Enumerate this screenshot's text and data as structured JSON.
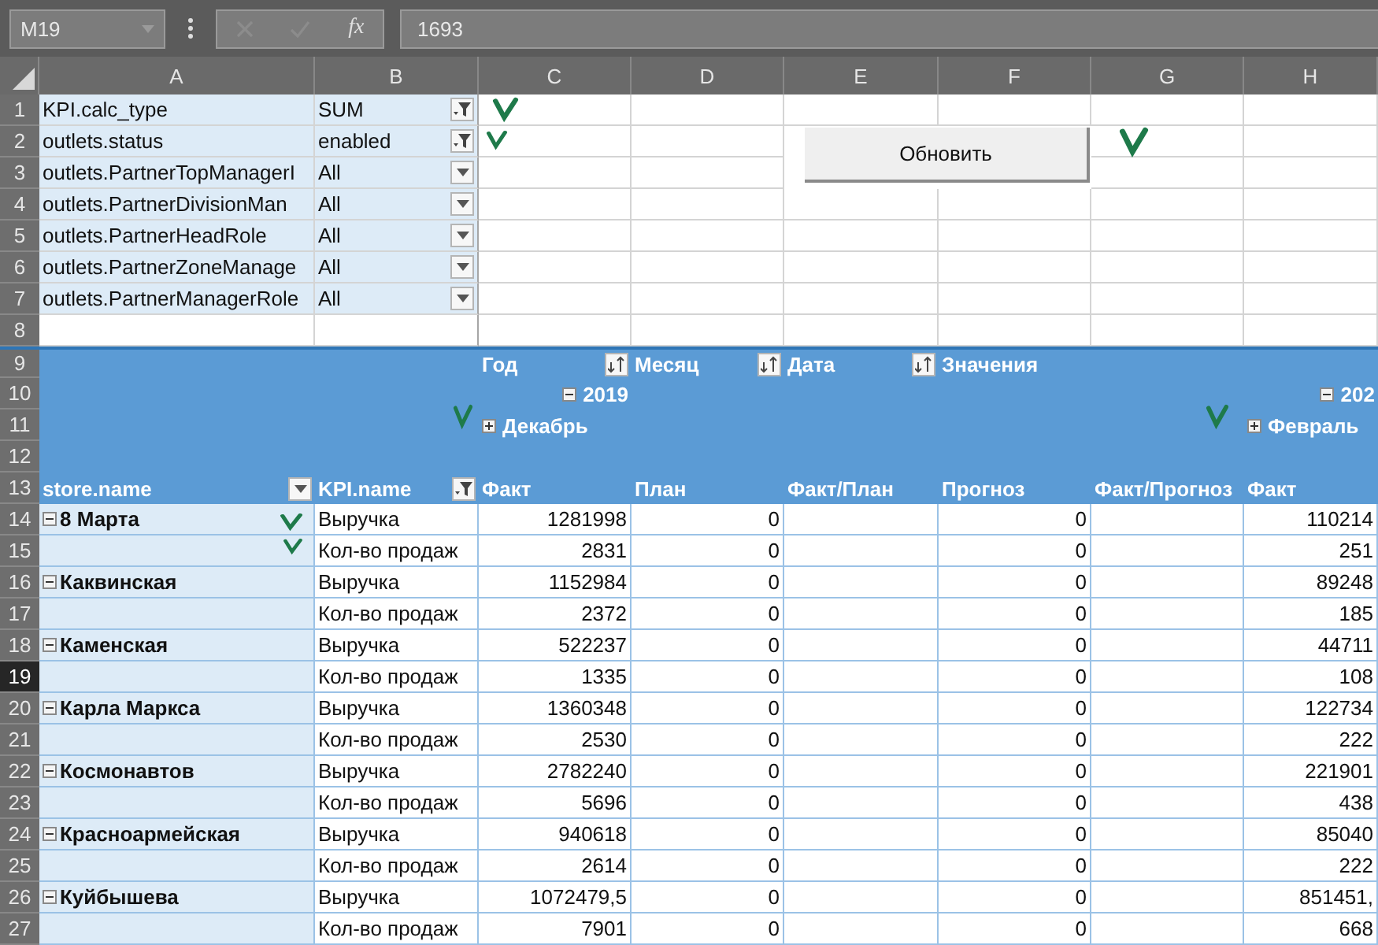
{
  "formula_bar": {
    "name_box": "M19",
    "fx_label": "fx",
    "formula": "1693"
  },
  "columns": [
    "A",
    "B",
    "C",
    "D",
    "E",
    "F",
    "G",
    "H"
  ],
  "row_numbers": [
    {
      "label": "1",
      "selected": false
    },
    {
      "label": "2",
      "selected": false
    },
    {
      "label": "3",
      "selected": false
    },
    {
      "label": "4",
      "selected": false
    },
    {
      "label": "5",
      "selected": false
    },
    {
      "label": "6",
      "selected": false
    },
    {
      "label": "7",
      "selected": false
    },
    {
      "label": "8",
      "selected": false
    },
    {
      "label": "9",
      "selected": false
    },
    {
      "label": "10",
      "selected": false
    },
    {
      "label": "11",
      "selected": false
    },
    {
      "label": "12",
      "selected": false
    },
    {
      "label": "13",
      "selected": false
    },
    {
      "label": "14",
      "selected": false
    },
    {
      "label": "15",
      "selected": false
    },
    {
      "label": "16",
      "selected": false
    },
    {
      "label": "17",
      "selected": false
    },
    {
      "label": "18",
      "selected": false
    },
    {
      "label": "19",
      "selected": true
    },
    {
      "label": "20",
      "selected": false
    },
    {
      "label": "21",
      "selected": false
    },
    {
      "label": "22",
      "selected": false
    },
    {
      "label": "23",
      "selected": false
    },
    {
      "label": "24",
      "selected": false
    },
    {
      "label": "25",
      "selected": false
    },
    {
      "label": "26",
      "selected": false
    },
    {
      "label": "27",
      "selected": false
    }
  ],
  "report_filters": [
    {
      "field": "KPI.calc_type",
      "value": "SUM",
      "filtered": true
    },
    {
      "field": "outlets.status",
      "value": "enabled",
      "filtered": true
    },
    {
      "field": "outlets.PartnerTopManagerI",
      "value": "All",
      "filtered": false
    },
    {
      "field": "outlets.PartnerDivisionMan",
      "value": "All",
      "filtered": false
    },
    {
      "field": "outlets.PartnerHeadRole",
      "value": "All",
      "filtered": false
    },
    {
      "field": "outlets.PartnerZoneManage",
      "value": "All",
      "filtered": false
    },
    {
      "field": "outlets.PartnerManagerRole",
      "value": "All",
      "filtered": false
    }
  ],
  "refresh_button": "Обновить",
  "pivot": {
    "column_fields": [
      {
        "label": "Год",
        "kind": "field"
      },
      {
        "label": "Месяц",
        "kind": "field"
      },
      {
        "label": "Дата",
        "kind": "field"
      },
      {
        "label": "Значения",
        "kind": "values"
      }
    ],
    "year_groups": [
      {
        "label": "2019",
        "expanded": true
      },
      {
        "label": "202",
        "expanded": true
      }
    ],
    "month_groups": [
      {
        "label": "Декабрь",
        "expanded": false
      },
      {
        "label": "Февраль",
        "expanded": false
      }
    ],
    "row_headers": [
      {
        "label": "store.name",
        "filtered": false
      },
      {
        "label": "KPI.name",
        "filtered": true
      }
    ],
    "value_headers": [
      "Факт",
      "План",
      "Факт/План",
      "Прогноз",
      "Факт/Прогноз",
      "Факт"
    ],
    "stores": [
      {
        "name": "8 Марта",
        "expanded": true,
        "rows": [
          {
            "kpi": "Выручка",
            "fact": "1281998",
            "plan": "0",
            "forecast": "0",
            "fact_2": "110214"
          },
          {
            "kpi": "Кол-во продаж",
            "fact": "2831",
            "plan": "0",
            "forecast": "0",
            "fact_2": "251"
          }
        ]
      },
      {
        "name": "Каквинская",
        "expanded": true,
        "rows": [
          {
            "kpi": "Выручка",
            "fact": "1152984",
            "plan": "0",
            "forecast": "0",
            "fact_2": "89248"
          },
          {
            "kpi": "Кол-во продаж",
            "fact": "2372",
            "plan": "0",
            "forecast": "0",
            "fact_2": "185"
          }
        ]
      },
      {
        "name": "Каменская",
        "expanded": true,
        "rows": [
          {
            "kpi": "Выручка",
            "fact": "522237",
            "plan": "0",
            "forecast": "0",
            "fact_2": "44711"
          },
          {
            "kpi": "Кол-во продаж",
            "fact": "1335",
            "plan": "0",
            "forecast": "0",
            "fact_2": "108"
          }
        ]
      },
      {
        "name": "Карла Маркса",
        "expanded": true,
        "rows": [
          {
            "kpi": "Выручка",
            "fact": "1360348",
            "plan": "0",
            "forecast": "0",
            "fact_2": "122734"
          },
          {
            "kpi": "Кол-во продаж",
            "fact": "2530",
            "plan": "0",
            "forecast": "0",
            "fact_2": "222"
          }
        ]
      },
      {
        "name": "Космонавтов",
        "expanded": true,
        "rows": [
          {
            "kpi": "Выручка",
            "fact": "2782240",
            "plan": "0",
            "forecast": "0",
            "fact_2": "221901"
          },
          {
            "kpi": "Кол-во продаж",
            "fact": "5696",
            "plan": "0",
            "forecast": "0",
            "fact_2": "438"
          }
        ]
      },
      {
        "name": "Красноармейская",
        "expanded": true,
        "rows": [
          {
            "kpi": "Выручка",
            "fact": "940618",
            "plan": "0",
            "forecast": "0",
            "fact_2": "85040"
          },
          {
            "kpi": "Кол-во продаж",
            "fact": "2614",
            "plan": "0",
            "forecast": "0",
            "fact_2": "222"
          }
        ]
      },
      {
        "name": "Куйбышева",
        "expanded": true,
        "rows": [
          {
            "kpi": "Выручка",
            "fact": "1072479,5",
            "plan": "0",
            "forecast": "0",
            "fact_2": "851451,"
          },
          {
            "kpi": "Кол-во продаж",
            "fact": "7901",
            "plan": "0",
            "forecast": "0",
            "fact_2": "668"
          }
        ]
      }
    ]
  }
}
